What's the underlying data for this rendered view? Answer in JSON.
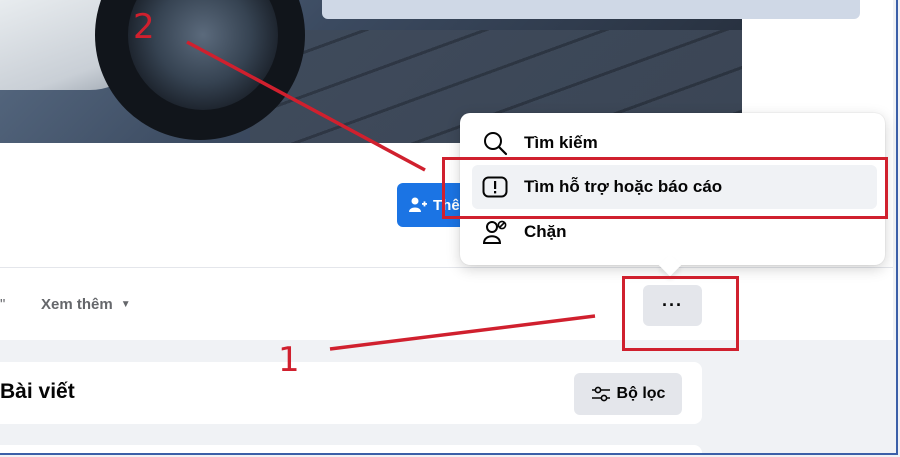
{
  "profile": {
    "add_friend_label": "Thê",
    "more_nav_label": "Xem thêm",
    "more_button_label": "···",
    "left_edge_text": "\""
  },
  "dropdown": {
    "items": [
      {
        "label": "Tìm kiếm",
        "icon": "search-icon"
      },
      {
        "label": "Tìm hỗ trợ hoặc báo cáo",
        "icon": "report-icon"
      },
      {
        "label": "Chặn",
        "icon": "block-user-icon"
      }
    ]
  },
  "posts": {
    "title": "Bài viết",
    "filter_label": "Bộ lọc"
  },
  "annotations": {
    "label_1": "1",
    "label_2": "2",
    "color": "#d0202e"
  },
  "colors": {
    "accent": "#1b74e4",
    "page_bg": "#f0f2f5",
    "button_bg": "#e4e6eb"
  }
}
